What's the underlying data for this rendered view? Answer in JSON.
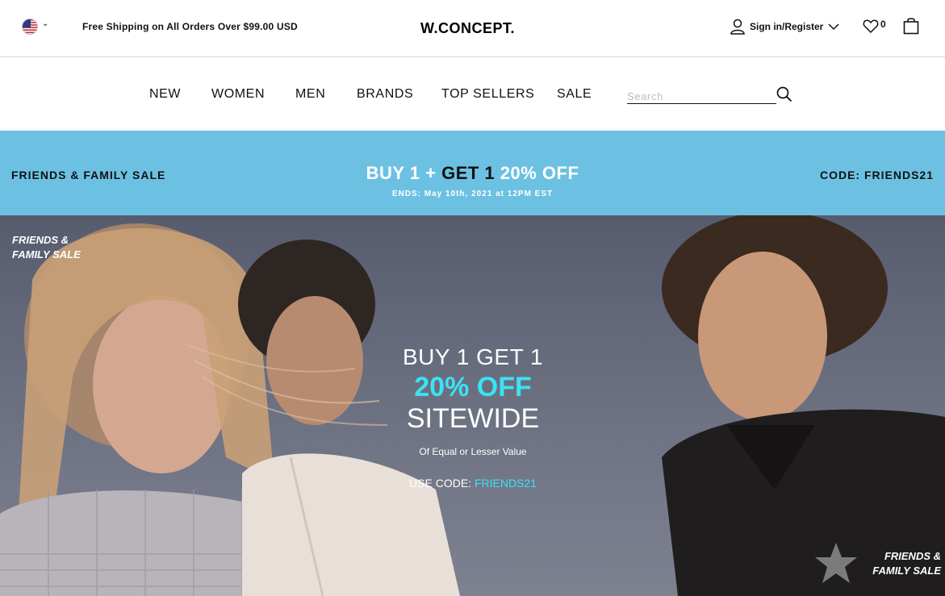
{
  "topbar": {
    "flag_icon": "us-flag-icon",
    "shipping_text": "Free Shipping on All Orders Over $99.00 USD",
    "logo": "W.CONCEPT.",
    "signin_label": "Sign in/Register",
    "wishlist_count": "0"
  },
  "nav": {
    "items": [
      "NEW",
      "WOMEN",
      "MEN",
      "BRANDS",
      "TOP SELLERS",
      "SALE"
    ],
    "search_placeholder": "Search"
  },
  "promo": {
    "left": "FRIENDS & FAMILY SALE",
    "main_part1": "BUY 1",
    "main_plus": "+",
    "main_part2": "GET 1",
    "main_part3": "20% OFF",
    "ends": "ENDS: May 10th, 2021 at 12PM EST",
    "right": "CODE: FRIENDS21",
    "color": "#6cc1e3"
  },
  "hero": {
    "tag_top_left": "FRIENDS & FAMILY SALE",
    "line1": "BUY 1 GET 1",
    "line2": "20% OFF",
    "line3": "SITEWIDE",
    "sub": "Of Equal or Lesser Value",
    "code_label": "USE CODE:",
    "code": "FRIENDS21",
    "tag_bottom_right": "FRIENDS & FAMILY SALE",
    "accent": "#3be3f2"
  }
}
